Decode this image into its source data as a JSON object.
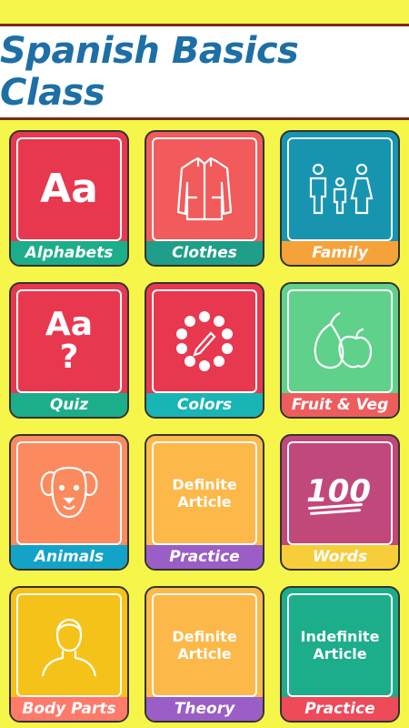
{
  "header": {
    "title": "Spanish Basics Class"
  },
  "tiles": [
    {
      "label": "Alphabets",
      "icon_text": "Aa",
      "icon": "alphabet-icon",
      "panel_color": "#e8384f",
      "label_color": "#1cae8a"
    },
    {
      "label": "Clothes",
      "icon": "jacket-icon",
      "panel_color": "#f25b5b",
      "label_color": "#1f9e89"
    },
    {
      "label": "Family",
      "icon": "family-icon",
      "panel_color": "#1795b0",
      "label_color": "#f5a23a"
    },
    {
      "label": "Quiz",
      "icon_text": "Aa",
      "icon_sub": "?",
      "icon": "quiz-icon",
      "panel_color": "#e8384f",
      "label_color": "#1cae8a"
    },
    {
      "label": "Colors",
      "icon": "palette-icon",
      "panel_color": "#e8384f",
      "label_color": "#19b5b5"
    },
    {
      "label": "Fruit & Veg",
      "icon": "fruit-icon",
      "panel_color": "#5fd18a",
      "label_color": "#ee5d5d"
    },
    {
      "label": "Animals",
      "icon": "dog-icon",
      "panel_color": "#fb8a5e",
      "label_color": "#13a3c8"
    },
    {
      "label": "Practice",
      "icon_text": "Definite Article",
      "icon": "definite-article-icon",
      "panel_color": "#fdb84a",
      "label_color": "#9a5ec6"
    },
    {
      "label": "Words",
      "icon": "hundred-icon",
      "panel_color": "#c1487a",
      "label_color": "#f8cd3a"
    },
    {
      "label": "Body Parts",
      "icon": "person-icon",
      "panel_color": "#f5c21a",
      "label_color": "#ff7a6a"
    },
    {
      "label": "Theory",
      "icon_text": "Definite Article",
      "icon": "definite-article-icon",
      "panel_color": "#fdb84a",
      "label_color": "#9a5ec6"
    },
    {
      "label": "Practice",
      "icon_text": "Indefinite Article",
      "icon": "indefinite-article-icon",
      "panel_color": "#1cae8a",
      "label_color": "#ee4a5a"
    }
  ]
}
